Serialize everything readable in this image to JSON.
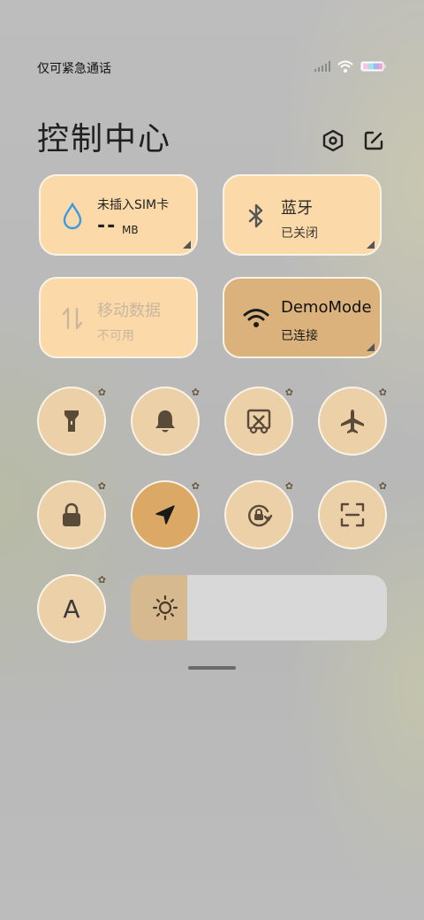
{
  "status_bar": {
    "carrier_text": "仅可紧急通话"
  },
  "header": {
    "title": "控制中心",
    "settings_icon": "hexagon-settings-icon",
    "edit_icon": "edit-icon"
  },
  "tiles": {
    "sim": {
      "title": "未插入SIM卡",
      "value": "--",
      "unit": "MB"
    },
    "bluetooth": {
      "title": "蓝牙",
      "status": "已关闭"
    },
    "mobile_data": {
      "title": "移动数据",
      "status": "不可用"
    },
    "wifi": {
      "title": "DemoMode",
      "status": "已连接"
    }
  },
  "toggles_row1": [
    "flashlight-icon",
    "bell-icon",
    "screenshot-icon",
    "airplane-icon"
  ],
  "toggles_row2": [
    "lock-icon",
    "location-icon",
    "rotation-lock-icon",
    "scan-icon"
  ],
  "auto_brightness_label": "A",
  "brightness_level": 0.22,
  "colors": {
    "tile": "#fcd9a8",
    "tile_active": "#dcb27c",
    "round": "#ecd0a7",
    "round_active": "#dca866",
    "accent_blue": "#3a9ae8"
  }
}
